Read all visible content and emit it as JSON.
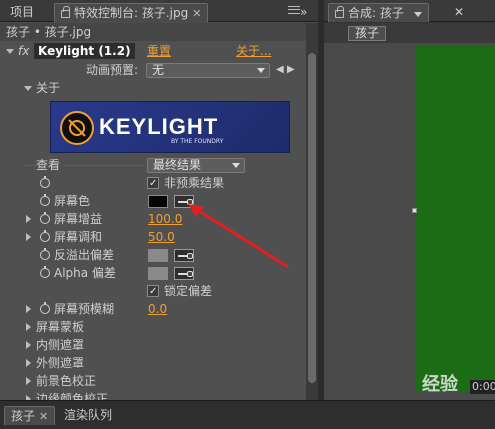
{
  "left_panel": {
    "tabs": [
      {
        "label": "项目"
      },
      {
        "label": "特效控制台: 孩子.jpg"
      }
    ],
    "layer_path": "孩子 • 孩子.jpg",
    "effect": {
      "name": "Keylight (1.2)",
      "reset": "重置",
      "about": "关于...",
      "preset_label": "动画预置:",
      "preset_value": "无"
    },
    "about_section": "关于",
    "logo": {
      "text": "KEYLIGHT",
      "sub": "BY THE FOUNDRY"
    },
    "view": {
      "label": "查看",
      "value": "最终结果"
    },
    "unpremult": "非预乘结果",
    "screen_color": "屏幕色",
    "screen_gain": {
      "label": "屏幕增益",
      "value": "100.0"
    },
    "screen_balance": {
      "label": "屏幕调和",
      "value": "50.0"
    },
    "despill_bias": "反溢出偏差",
    "alpha_bias": "Alpha 偏差",
    "lock_bias": "锁定偏差",
    "screen_preblur": {
      "label": "屏幕预模糊",
      "value": "0.0"
    },
    "groups": [
      "屏幕蒙板",
      "内侧遮罩",
      "外侧遮罩",
      "前景色校正",
      "边缘颜色校正"
    ]
  },
  "right_panel": {
    "tab": "合成: 孩子",
    "comp_button": "孩子",
    "timecode": "0:00"
  },
  "bottom_panel": {
    "tabs": [
      {
        "label": "孩子"
      },
      {
        "label": "渲染队列"
      }
    ]
  },
  "watermark": "经验",
  "colors": {
    "accent_value": "#f0a030",
    "comp_background": "#1c6b15",
    "screen_color_swatch": "#050505",
    "arrow": "#e02020"
  }
}
